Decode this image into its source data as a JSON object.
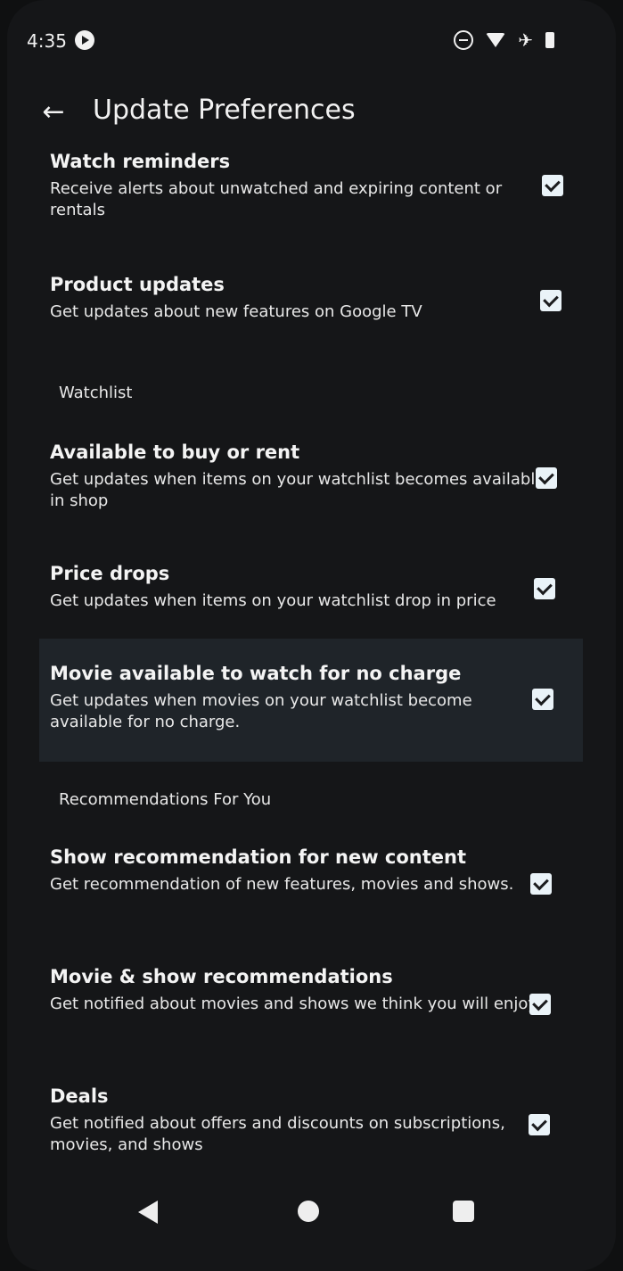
{
  "status_bar": {
    "time": "4:35"
  },
  "header": {
    "title": "Update Preferences"
  },
  "items": [
    {
      "title": "Watch reminders",
      "subtitle": "Receive alerts about unwatched and expiring content or rentals",
      "checked": true
    },
    {
      "title": "Product updates",
      "subtitle": "Get updates about new features on Google TV",
      "checked": true
    }
  ],
  "sections": [
    {
      "header": "Watchlist",
      "items": [
        {
          "title": "Available to buy or rent",
          "subtitle": "Get updates when items on your watchlist becomes available in shop",
          "checked": true
        },
        {
          "title": "Price drops",
          "subtitle": "Get updates when items on your watchlist drop in price",
          "checked": true
        },
        {
          "title": "Movie available to watch for no charge",
          "subtitle": "Get updates when movies on your watchlist become available for no charge.",
          "checked": true
        }
      ]
    },
    {
      "header": "Recommendations For You",
      "items": [
        {
          "title": "Show recommendation for new content",
          "subtitle": "Get recommendation of new features, movies and shows.",
          "checked": true
        },
        {
          "title": "Movie & show recommendations",
          "subtitle": "Get notified about movies and shows we think you will enjoy",
          "checked": true
        },
        {
          "title": "Deals",
          "subtitle": "Get notified about offers and discounts on subscriptions, movies, and shows",
          "checked": true
        }
      ]
    }
  ]
}
